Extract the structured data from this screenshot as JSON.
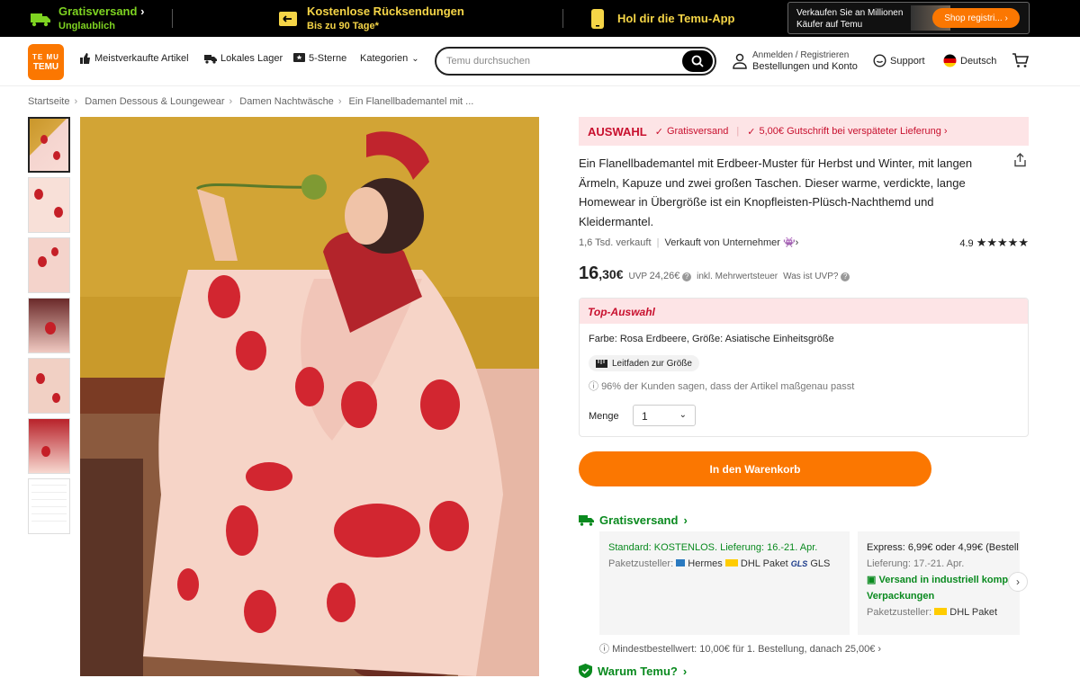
{
  "topbar": {
    "shipping_title": "Gratisversand",
    "shipping_sub": "Unglaublich",
    "returns_title": "Kostenlose Rücksendungen",
    "returns_sub": "Bis zu 90 Tage*",
    "app": "Hol dir die Temu-App",
    "seller_text1": "Verkaufen Sie an Millionen",
    "seller_text2": "Käufer auf Temu",
    "seller_button": "Shop registri..."
  },
  "header": {
    "logo_line1": "TE MU",
    "logo_line2": "TEMU",
    "nav": {
      "bestsellers": "Meistverkaufte Artikel",
      "local": "Lokales Lager",
      "five_star": "5-Sterne",
      "categories": "Kategorien"
    },
    "search_placeholder": "Temu durchsuchen",
    "login_line1": "Anmelden / Registrieren",
    "login_line2": "Bestellungen und Konto",
    "support": "Support",
    "language": "Deutsch"
  },
  "breadcrumb": [
    "Startseite",
    "Damen Dessous & Loungewear",
    "Damen Nachtwäsche",
    "Ein Flanellbademantel mit ..."
  ],
  "product": {
    "auswahl_label": "AUSWAHL",
    "free_shipping": "Gratisversand",
    "credit": "5,00€ Gutschrift bei verspäteter Lieferung",
    "title": "Ein Flanellbademantel mit Erdbeer-Muster für Herbst und Winter, mit langen Ärmeln, Kapuze und zwei großen Taschen. Dieser warme, verdickte, lange Homewear in Übergröße ist ein Knopfleisten-Plüsch-Nachthemd und Kleidermantel.",
    "sold": "1,6 Tsd. verkauft",
    "seller": "Verkauft von Unternehmer",
    "rating": "4.9",
    "rating_value": 4.9,
    "price_int": "16",
    "price_dec": ",30€",
    "uvp_label": "UVP",
    "uvp_value": "24,26€",
    "tax_note": "inkl. Mehrwertsteuer",
    "uvp_question": "Was ist UVP?"
  },
  "selection": {
    "header": "Top-Auswahl",
    "variant": "Farbe: Rosa Erdbeere, Größe: Asiatische Einheitsgröße",
    "size_guide": "Leitfaden zur Größe",
    "fit_note": "96% der Kunden sagen, dass der Artikel maßgenau passt",
    "quantity_label": "Menge",
    "quantity_value": "1"
  },
  "cart_button": "In den Warenkorb",
  "shipping": {
    "title": "Gratisversand",
    "standard_line1": "Standard: KOSTENLOS. Lieferung: 16.-21. Apr.",
    "standard_carriers_label": "Paketzusteller:",
    "carrier1": "Hermes",
    "carrier2": "DHL Paket",
    "carrier3": "GLS",
    "express_line1": "Express: 6,99€ oder 4,99€ (Bestell",
    "express_line2": "Lieferung: 17.-21. Apr.",
    "express_green1": "Versand in industriell komp",
    "express_green2": "Verpackungen",
    "express_carriers_label": "Paketzusteller:",
    "express_carrier": "DHL Paket",
    "min_order": "Mindestbestellwert: 10,00€ für 1. Bestellung, danach 25,00€"
  },
  "why_temu": "Warum Temu?",
  "colors": {
    "accent": "#fb7701",
    "green": "#0a8a1f",
    "red": "#c8102e",
    "pink_bg": "#fde4e6"
  }
}
